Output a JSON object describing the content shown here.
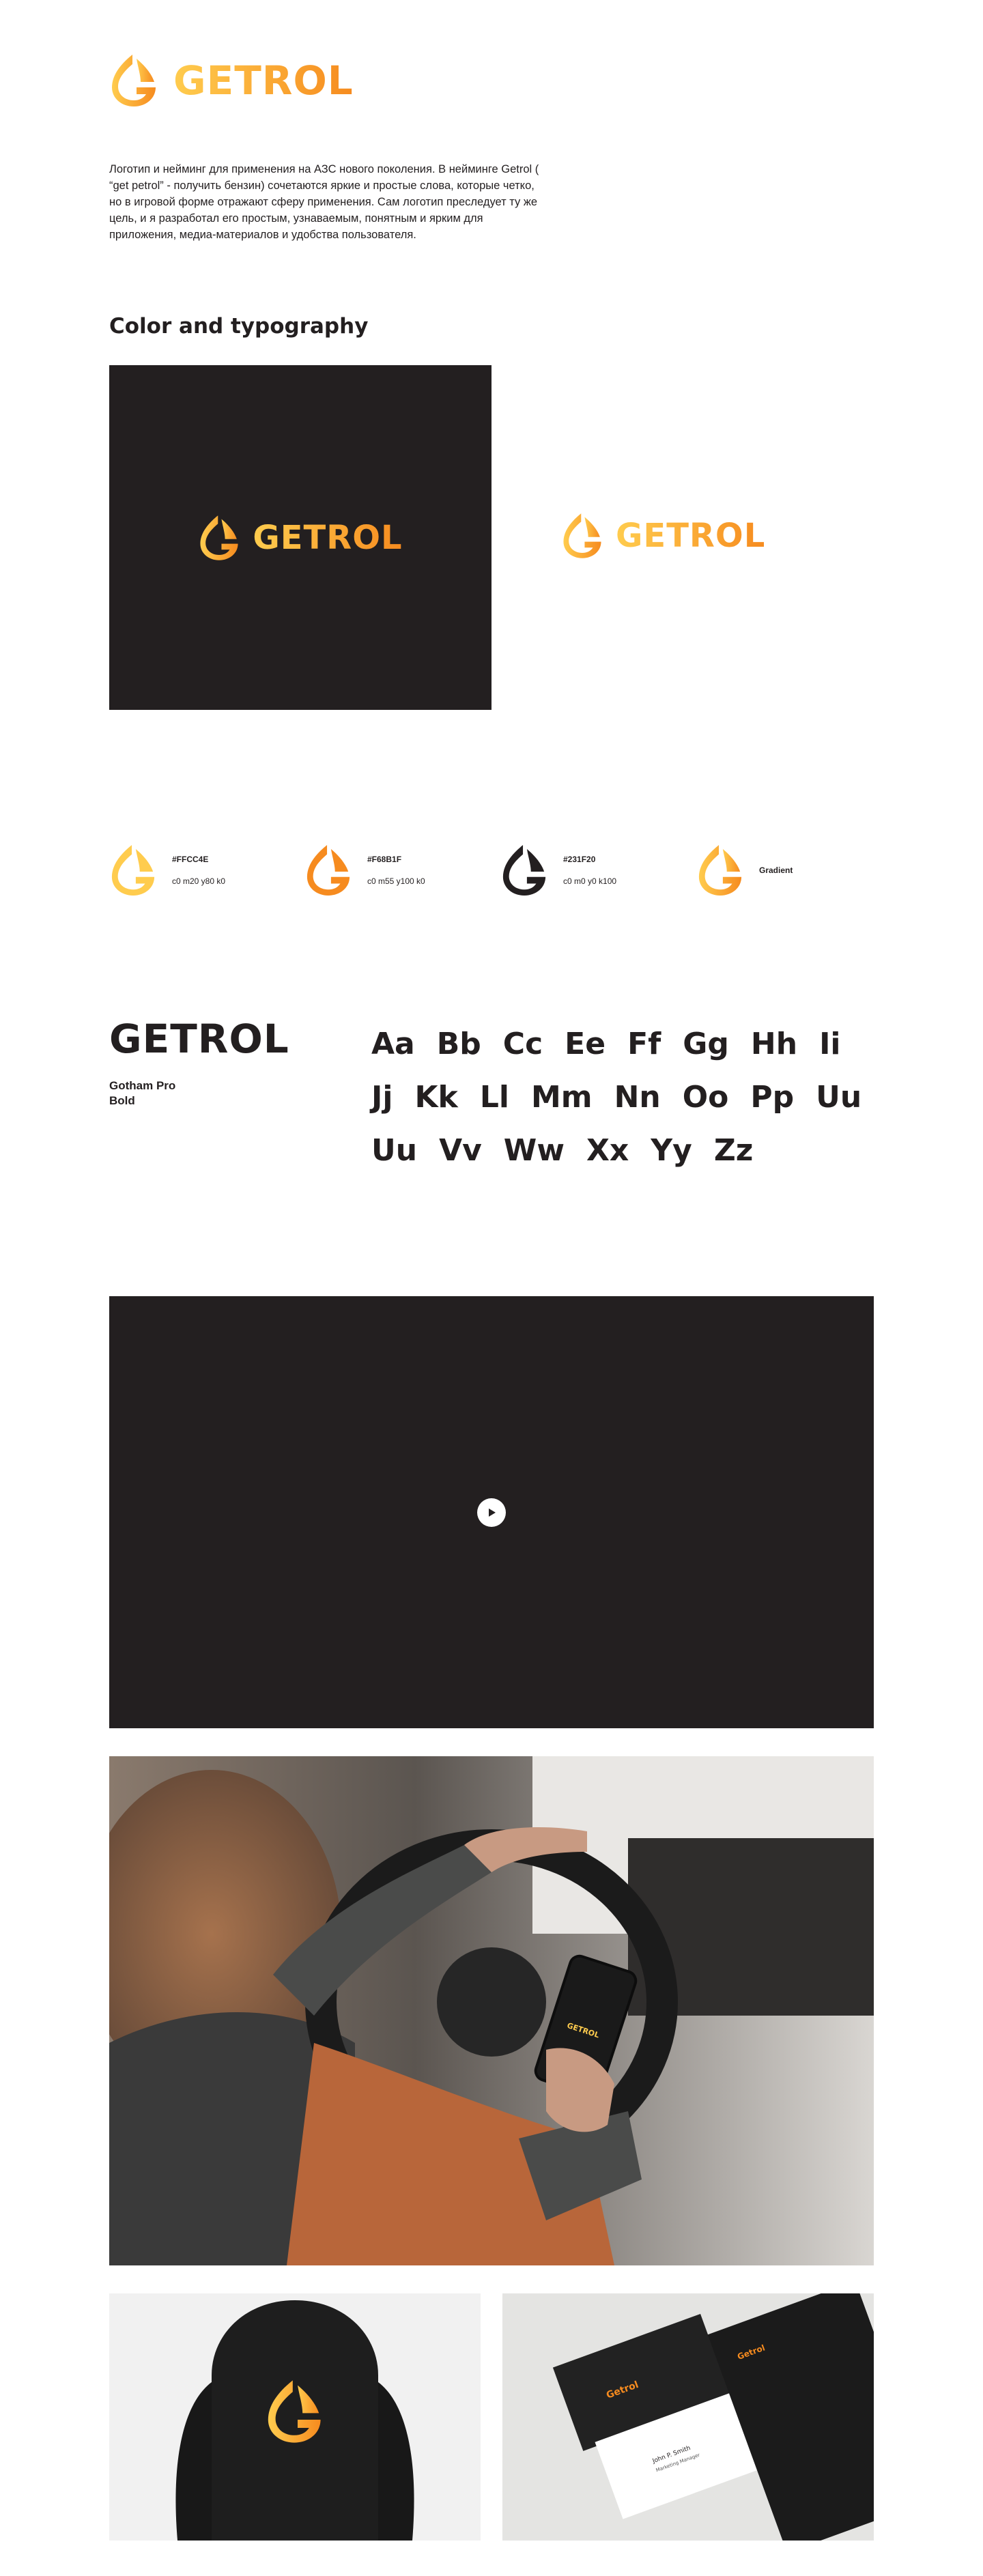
{
  "brand": {
    "name": "GETROL",
    "gradient": [
      "#FFCC4E",
      "#F68B1F"
    ],
    "dark": "#231F20"
  },
  "intro": {
    "text": "Логотип и нейминг для применения на АЗС нового поколения. В нейминге Getrol ( “get petrol” - получить бензин) сочетаются яркие и простые слова, которые четко, но в игровой форме отражают сферу применения. Сам логотип преследует ту же цель, и я разработал его простым, узнаваемым, понятным и ярким для приложения, медиа-материалов и удобства пользователя."
  },
  "sections": {
    "color_typography_title": "Color and typography"
  },
  "colors": [
    {
      "hex": "#FFCC4E",
      "cmyk": "c0 m20 y80 k0",
      "fill": "#FFCC4E"
    },
    {
      "hex": "#F68B1F",
      "cmyk": "c0 m55 y100 k0",
      "fill": "#F68B1F"
    },
    {
      "hex": "#231F20",
      "cmyk": "c0 m0 y0 k100",
      "fill": "#231F20"
    },
    {
      "label": "Gradient",
      "fill": "gradient"
    }
  ],
  "typography": {
    "sample": "GETROL",
    "font_line1": "Gotham Pro",
    "font_line2": "Bold",
    "rows": [
      [
        "Aa",
        "Bb",
        "Cc",
        "Ee",
        "Ff",
        "Gg",
        "Hh",
        "Ii"
      ],
      [
        "Jj",
        "Kk",
        "Ll",
        "Mm",
        "Nn",
        "Oo",
        "Pp",
        "Uu"
      ],
      [
        "Uu",
        "Vv",
        "Ww",
        "Xx",
        "Yy",
        "Zz"
      ]
    ]
  },
  "mockups": {
    "phone_logo": "GETROL",
    "card_logo": "Getrol",
    "card_name": "John P. Smith",
    "card_role": "Marketing Manager"
  },
  "icons": {
    "logo": "flame-g-logo-icon",
    "play": "play-icon"
  }
}
